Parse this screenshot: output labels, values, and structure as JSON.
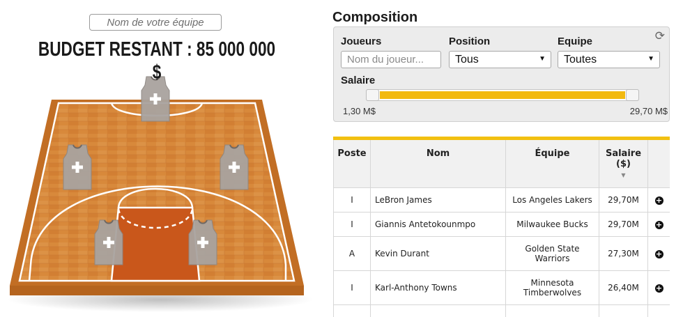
{
  "team": {
    "name_placeholder": "Nom de votre équipe"
  },
  "budget": {
    "text": "BUDGET RESTANT : 85 000 000 $"
  },
  "composition": {
    "title": "Composition",
    "filters": {
      "players_label": "Joueurs",
      "players_placeholder": "Nom du joueur...",
      "position_label": "Position",
      "position_value": "Tous",
      "team_label": "Equipe",
      "team_value": "Toutes",
      "salary_label": "Salaire",
      "salary_min": "1,30 M$",
      "salary_max": "29,70 M$",
      "refresh_icon": "refresh-icon"
    },
    "table": {
      "headers": {
        "poste": "Poste",
        "nom": "Nom",
        "equipe": "Équipe",
        "salaire": "Salaire ($)"
      },
      "rows": [
        {
          "poste": "I",
          "nom": "LeBron James",
          "equipe": "Los Angeles Lakers",
          "salaire": "29,70M"
        },
        {
          "poste": "I",
          "nom": "Giannis Antetokounmpo",
          "equipe": "Milwaukee Bucks",
          "salaire": "29,70M"
        },
        {
          "poste": "A",
          "nom": "Kevin Durant",
          "equipe": "Golden State Warriors",
          "salaire": "27,30M"
        },
        {
          "poste": "I",
          "nom": "Karl-Anthony Towns",
          "equipe": "Minnesota Timberwolves",
          "salaire": "26,40M"
        }
      ]
    }
  },
  "colors": {
    "accent": "#f2b90f",
    "court_wood": "#d8883a",
    "court_edge": "#b5641e",
    "jersey": "#a9a39f"
  }
}
